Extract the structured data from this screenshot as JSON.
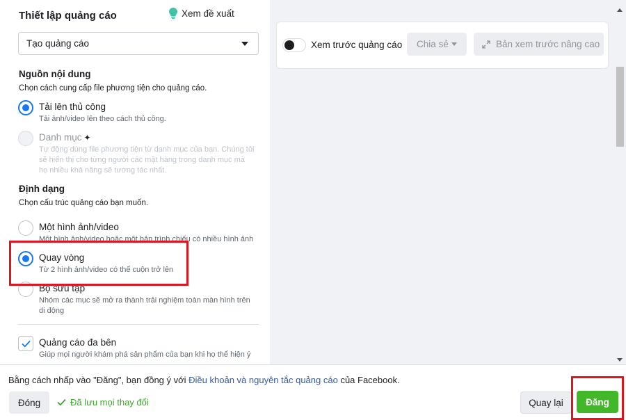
{
  "panel": {
    "title": "Thiết lập quảng cáo",
    "suggest_label": "Xem đề xuất",
    "dropdown_value": "Tạo quảng cáo"
  },
  "content_source": {
    "title": "Nguồn nội dung",
    "desc": "Chọn cách cung cấp file phương tiện cho quảng cáo.",
    "options": [
      {
        "label": "Tải lên thủ công",
        "desc": "Tải ảnh/video lên theo cách thủ công.",
        "selected": true
      },
      {
        "label": "Danh mục",
        "desc": "Tự động dùng file phương tiện từ danh mục của bạn. Chúng tôi sẽ hiển thị cho từng người các mặt hàng trong danh mục mà họ nhiều khả năng sẽ tương tác nhất.",
        "disabled": true
      }
    ]
  },
  "format": {
    "title": "Định dạng",
    "desc": "Chọn cấu trúc quảng cáo bạn muốn.",
    "options": [
      {
        "label": "Một hình ảnh/video",
        "desc": "Một hình ảnh/video hoặc một bản trình chiếu có nhiều hình ảnh",
        "selected": false
      },
      {
        "label": "Quay vòng",
        "desc": "Từ 2 hình ảnh/video có thể cuộn trở lên",
        "selected": true
      },
      {
        "label": "Bộ sưu tập",
        "desc": "Nhóm các mục sẽ mở ra thành trải nghiệm toàn màn hình trên di động",
        "selected": false
      }
    ],
    "multi_advertiser": {
      "label": "Quảng cáo đa bên",
      "desc": "Giúp mọi người khám phá sản phẩm của bạn khi họ thể hiện ý",
      "checked": true
    }
  },
  "preview": {
    "toggle_label": "Xem trước quảng cáo",
    "share_label": "Chia sẻ",
    "advanced_label": "Bản xem trước nâng cao"
  },
  "footer": {
    "consent_prefix": "Bằng cách nhấp vào \"Đăng\", bạn đồng ý với ",
    "consent_link": "Điều khoản và nguyên tắc quảng cáo",
    "consent_suffix": " của Facebook.",
    "close_label": "Đóng",
    "saved_label": "Đã lưu mọi thay đổi",
    "back_label": "Quay lại",
    "publish_label": "Đăng"
  },
  "colors": {
    "accent": "#1877f2",
    "publish": "#42b72a",
    "highlight": "#e0161e",
    "link": "#385898"
  }
}
